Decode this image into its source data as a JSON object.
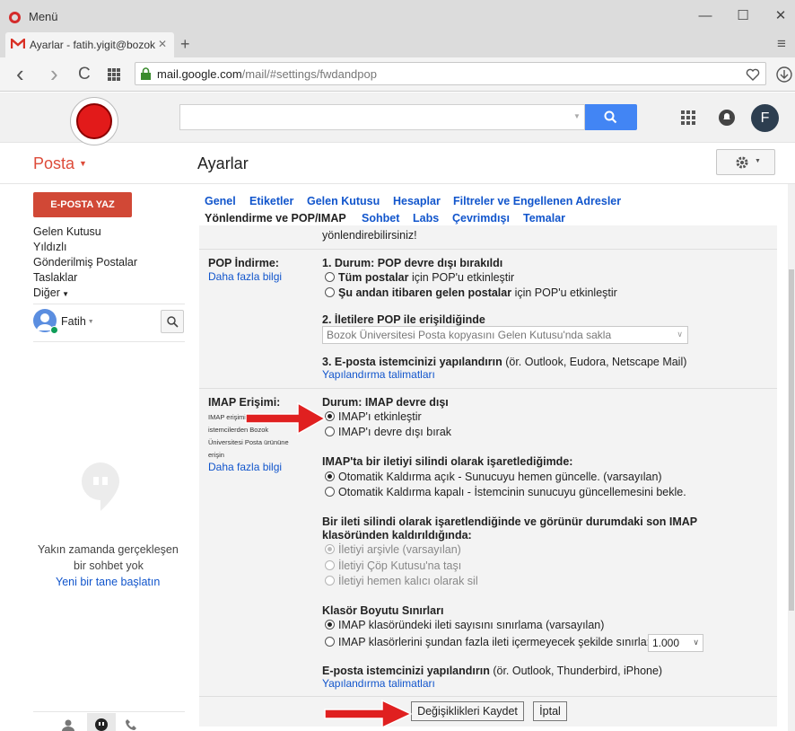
{
  "window": {
    "title": "Menü",
    "minimize": "—",
    "maximize": "☐",
    "close": "✕"
  },
  "tab": {
    "title": "Ayarlar - fatih.yigit@bozok",
    "close": "✕",
    "new": "+",
    "menu": "≡"
  },
  "address": {
    "url_host": "mail.google.com",
    "url_path": "/mail/#settings/fwdandpop",
    "back": "‹",
    "forward": "›",
    "reload": "C"
  },
  "gmail": {
    "brand": "Posta",
    "page_title": "Ayarlar",
    "avatar": "F",
    "compose": "E-POSTA YAZ",
    "nav": [
      "Gelen Kutusu",
      "Yıldızlı",
      "Gönderilmiş Postalar",
      "Taslaklar",
      "Diğer"
    ],
    "user": "Fatih",
    "chat": {
      "line1": "Yakın zamanda gerçekleşen",
      "line2": "bir sohbet yok",
      "link": "Yeni bir tane başlatın"
    },
    "tabs_row1": [
      "Genel",
      "Etiketler",
      "Gelen Kutusu",
      "Hesaplar",
      "Filtreler ve Engellenen Adresler"
    ],
    "tabs_row2_active": "Yönlendirme ve POP/IMAP",
    "tabs_row2": [
      "Sohbet",
      "Labs",
      "Çevrimdışı",
      "Temalar"
    ]
  },
  "settings": {
    "top_cut": "yönlendirebilirsiniz!",
    "pop": {
      "label": "POP İndirme:",
      "learn": "Daha fazla bilgi",
      "h1": "1. Durum: POP devre dışı bırakıldı",
      "o1_b": "Tüm postalar",
      "o1": " için POP'u etkinleştir",
      "o2_b": "Şu andan itibaren gelen postalar",
      "o2": " için POP'u etkinleştir",
      "h2": "2. İletilere POP ile erişildiğinde",
      "select": "Bozok Üniversitesi Posta kopyasını Gelen Kutusu'nda sakla",
      "h3_b": "3. E-posta istemcinizi yapılandırın",
      "h3": " (ör. Outlook, Eudora, Netscape Mail)",
      "config": "Yapılandırma talimatları"
    },
    "imap": {
      "label": "IMAP Erişimi:",
      "desc": [
        "IMAP erişimi",
        "istemcilerden Bozok",
        "Üniversitesi Posta ürününe",
        "erişin"
      ],
      "learn": "Daha fazla bilgi",
      "status": "Durum: IMAP devre dışı",
      "enable": "IMAP'ı etkinleştir",
      "disable": "IMAP'ı devre dışı bırak",
      "del_h": "IMAP'ta bir iletiyi silindi olarak işaretlediğimde:",
      "del_o1": "Otomatik Kaldırma açık - Sunucuyu hemen güncelle. (varsayılan)",
      "del_o2": "Otomatik Kaldırma kapalı - İstemcinin sunucuyu güncellemesini bekle.",
      "exp_h1": "Bir ileti silindi olarak işaretlendiğinde ve görünür durumdaki son IMAP",
      "exp_h2": "klasöründen kaldırıldığında:",
      "exp_o1": "İletiyi arşivle (varsayılan)",
      "exp_o2": "İletiyi Çöp Kutusu'na taşı",
      "exp_o3": "İletiyi hemen kalıcı olarak sil",
      "fold_h": "Klasör Boyutu Sınırları",
      "fold_o1": "IMAP klasöründeki ileti sayısını sınırlama (varsayılan)",
      "fold_o2": "IMAP klasörlerini şundan fazla ileti içermeyecek şekilde sınırla:",
      "fold_val": "1.000",
      "cfg_b": "E-posta istemcinizi yapılandırın",
      "cfg": " (ör. Outlook, Thunderbird, iPhone)",
      "cfg_link": "Yapılandırma talimatları"
    },
    "save": "Değişiklikleri Kaydet",
    "cancel": "İptal"
  },
  "colors": {
    "accent": "#4285f4",
    "compose": "#d14836",
    "link": "#1155cc",
    "brand": "#dd4b39",
    "arrow": "#e02020"
  }
}
